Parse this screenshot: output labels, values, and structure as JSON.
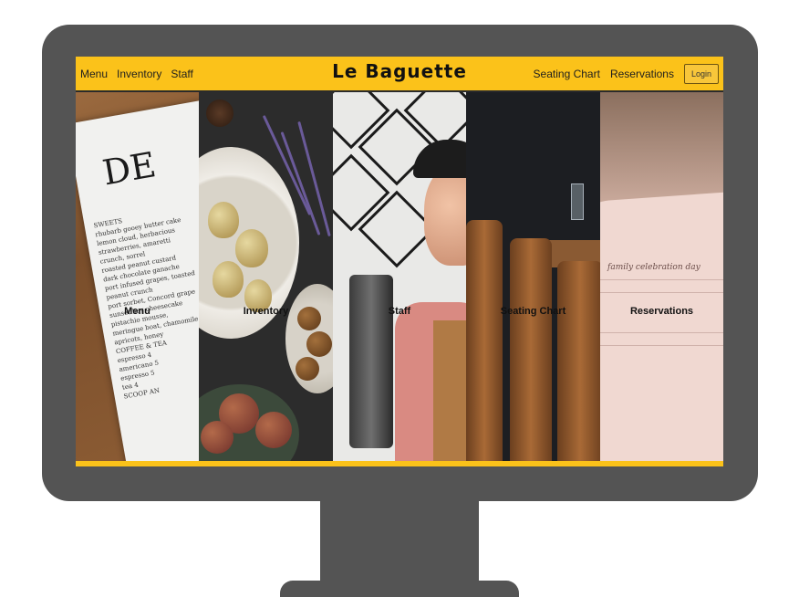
{
  "navbar": {
    "left_links": [
      "Menu",
      "Inventory",
      "Staff"
    ],
    "brand": "Le Baguette",
    "right_links": [
      "Seating Chart",
      "Reservations"
    ],
    "login_label": "Login"
  },
  "panels": [
    {
      "label": "Menu"
    },
    {
      "label": "Inventory"
    },
    {
      "label": "Staff"
    },
    {
      "label": "Seating Chart"
    },
    {
      "label": "Reservations"
    }
  ],
  "menu_photo": {
    "heading": "DE",
    "lines": [
      "SWEETS",
      "rhubarb gooey butter cake",
      "lemon cloud, herbacious",
      "strawberries, amaretti",
      "crunch, sorrel",
      "roasted peanut custard",
      "dark chocolate ganache",
      "port infused grapes, toasted",
      "peanut crunch",
      "port sorbet, Concord grape",
      "sunset bay cheesecake",
      "pistachio mousse,",
      "meringue boat, chamomile",
      "apricots, honey",
      "COFFEE & TEA",
      "espresso 4",
      "americano 5",
      "espresso 5",
      "tea 4",
      "SCOOP AN"
    ]
  },
  "reservations_photo": {
    "script": "family celebration day"
  },
  "colors": {
    "accent": "#fbc21a",
    "monitor": "#545454"
  }
}
